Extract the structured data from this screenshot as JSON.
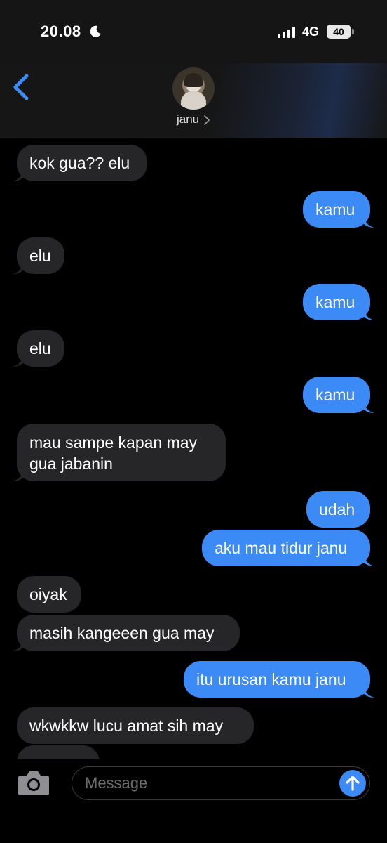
{
  "status_bar": {
    "time": "20.08",
    "network": "4G",
    "battery": "40"
  },
  "header": {
    "contact_name": "janu"
  },
  "messages": [
    {
      "side": "received",
      "text": "kok gua?? elu"
    },
    {
      "side": "sent",
      "text": "kamu"
    },
    {
      "side": "received",
      "text": "elu"
    },
    {
      "side": "sent",
      "text": "kamu"
    },
    {
      "side": "received",
      "text": "elu"
    },
    {
      "side": "sent",
      "text": "kamu"
    },
    {
      "side": "received",
      "line1": "mau sampe kapan may",
      "line2": "gua jabanin"
    },
    {
      "side": "sent",
      "text": "udah"
    },
    {
      "side": "sent",
      "text": "aku mau tidur janu"
    },
    {
      "side": "received",
      "text": "oiyak"
    },
    {
      "side": "received",
      "text": "masih kangeeen gua may"
    },
    {
      "side": "sent",
      "text": "itu urusan kamu janu"
    },
    {
      "side": "received",
      "text": "wkwkkw lucu amat sih may"
    }
  ],
  "composer": {
    "placeholder": "Message"
  },
  "colors": {
    "sent_bubble": "#3b8af5",
    "received_bubble": "#262629",
    "accent": "#3b8af5"
  }
}
